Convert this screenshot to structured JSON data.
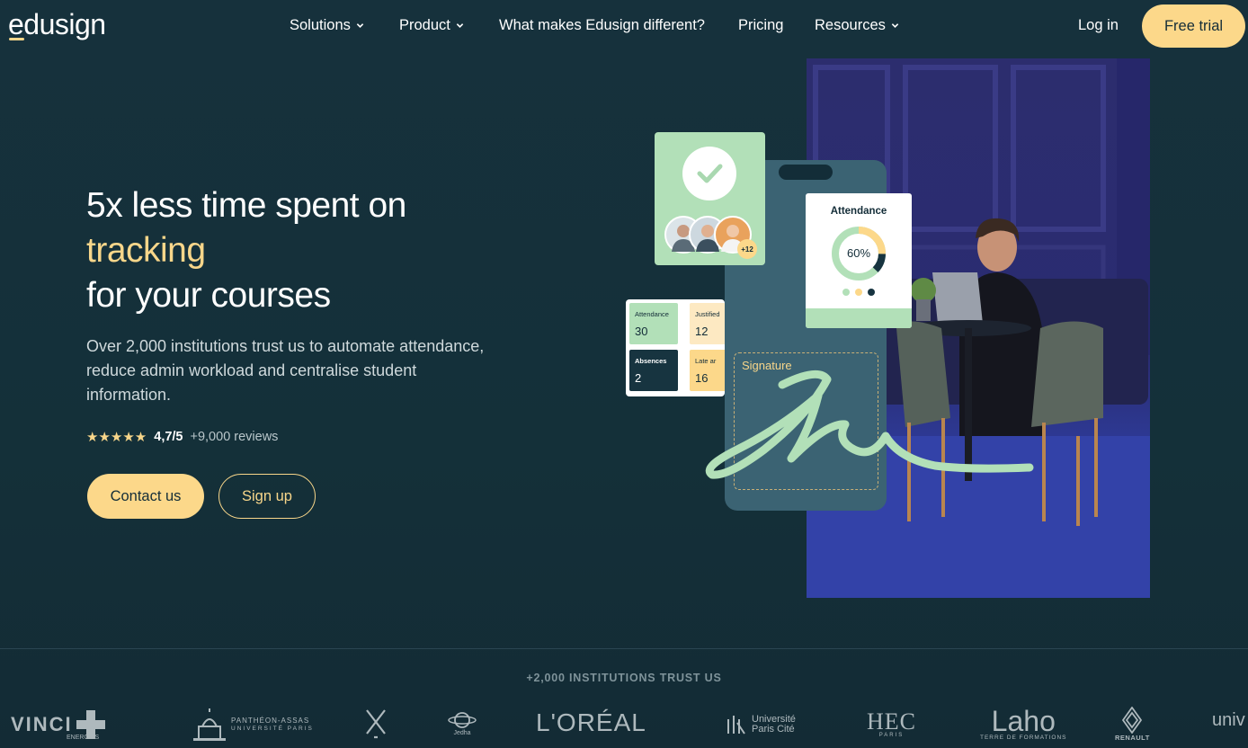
{
  "brand": {
    "name": "edusign"
  },
  "nav": {
    "items": [
      {
        "label": "Solutions",
        "dropdown": true
      },
      {
        "label": "Product",
        "dropdown": true
      },
      {
        "label": "What makes Edusign different?",
        "dropdown": false
      },
      {
        "label": "Pricing",
        "dropdown": false
      },
      {
        "label": "Resources",
        "dropdown": true
      }
    ],
    "login": "Log in",
    "free_trial": "Free trial"
  },
  "hero": {
    "title_line1": "5x less time spent on",
    "title_accent": "tracking",
    "title_line3": "for your courses",
    "subtitle": "Over 2,000 institutions trust us to automate attendance, reduce admin workload and centralise student information.",
    "stars": "★★★★★",
    "rating": "4,7/5",
    "reviews": "+9,000 reviews",
    "contact": "Contact us",
    "signup": "Sign up"
  },
  "visual": {
    "avatar_extra": "+12",
    "stats": [
      {
        "label": "Attendance",
        "value": "30"
      },
      {
        "label": "Justified",
        "value": "12"
      },
      {
        "label": "Absences",
        "value": "2"
      },
      {
        "label": "Late ar",
        "value": "16"
      }
    ],
    "attendance_card": {
      "title": "Attendance",
      "percent_label": "60%",
      "percent": 60
    },
    "signature_label": "Signature"
  },
  "trust": {
    "title": "+2,000 INSTITUTIONS TRUST US",
    "logos": [
      {
        "name": "VINCI",
        "sub": "ENERGIES"
      },
      {
        "name": "PANTHÉON-ASSAS",
        "sub": "UNIVERSITÉ PARIS"
      },
      {
        "name": "Jedha"
      },
      {
        "name": "L'ORÉAL"
      },
      {
        "name": "Université",
        "sub": "Paris Cité"
      },
      {
        "name": "HEC",
        "sub": "PARIS"
      },
      {
        "name": "Laho",
        "sub": "TERRE DE FORMATIONS"
      },
      {
        "name": "RENAULT"
      },
      {
        "name": "univ"
      }
    ]
  },
  "colors": {
    "background": "#132d38",
    "accent_yellow": "#fcd88a",
    "accent_green": "#b2e0b8",
    "phone": "#3b6373"
  }
}
